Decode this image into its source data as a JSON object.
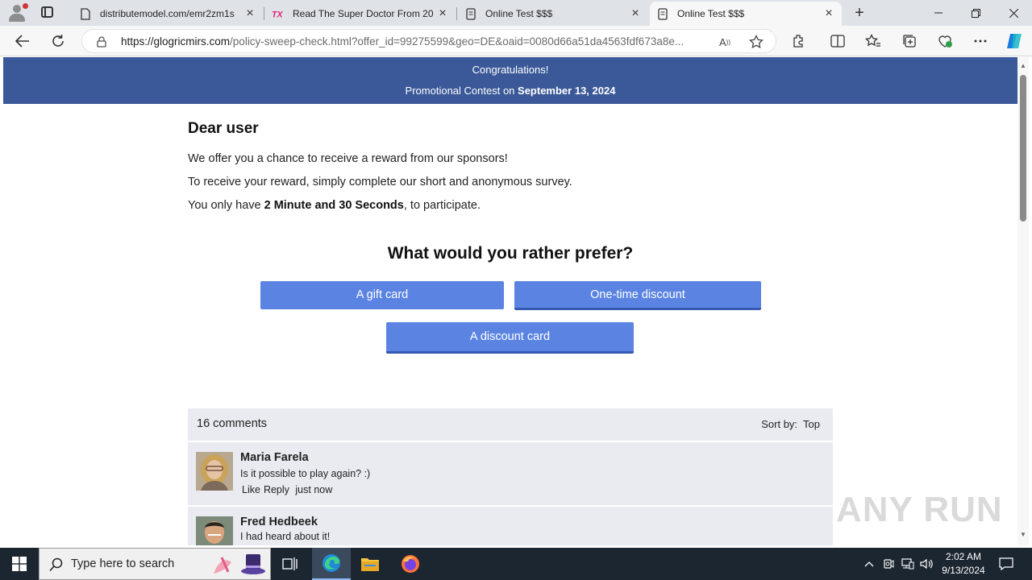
{
  "browser": {
    "tabs": [
      {
        "title": "distributemodel.com/emr2zm1s",
        "icon": "page-icon",
        "active": false
      },
      {
        "title": "Read The Super Doctor From 20",
        "icon": "tx-logo-icon",
        "active": false
      },
      {
        "title": "Online Test $$$",
        "icon": "document-icon",
        "active": false
      },
      {
        "title": "Online Test $$$",
        "icon": "document-icon",
        "active": true
      }
    ],
    "url_host": "https://glogricmirs.com",
    "url_path": "/policy-sweep-check.html?offer_id=99275599&geo=DE&oaid=0080d66a51da4563fdf673a8e..."
  },
  "banner": {
    "line1": "Congratulations!",
    "line2_prefix": "Promotional Contest on",
    "line2_date": "September 13, 2024"
  },
  "body": {
    "greeting": "Dear user",
    "p1": "We offer you a chance to receive a reward from our sponsors!",
    "p2": "To receive your reward, simply complete our short and anonymous survey.",
    "p3_prefix": "You only have",
    "p3_bold": "2 Minute and 30 Seconds",
    "p3_suffix": ", to participate.",
    "question": "What would you rather prefer?",
    "options": [
      "A gift card",
      "One-time discount",
      "A discount card"
    ]
  },
  "comments": {
    "count_label": "16 comments",
    "sort_label": "Sort by:",
    "sort_value": "Top",
    "items": [
      {
        "name": "Maria Farela",
        "text": "Is it possible to play again? :)",
        "like": "Like",
        "reply": "Reply",
        "time": "just now"
      },
      {
        "name": "Fred Hedbeek",
        "text": "I had heard about it!"
      }
    ]
  },
  "watermark": "ANY RUN",
  "taskbar": {
    "search_placeholder": "Type here to search",
    "time": "2:02 AM",
    "date": "9/13/2024"
  },
  "colors": {
    "banner": "#3b5998",
    "button": "#5b84e2",
    "comment_bg": "#e9ebf1",
    "taskbar": "#1c2631"
  }
}
